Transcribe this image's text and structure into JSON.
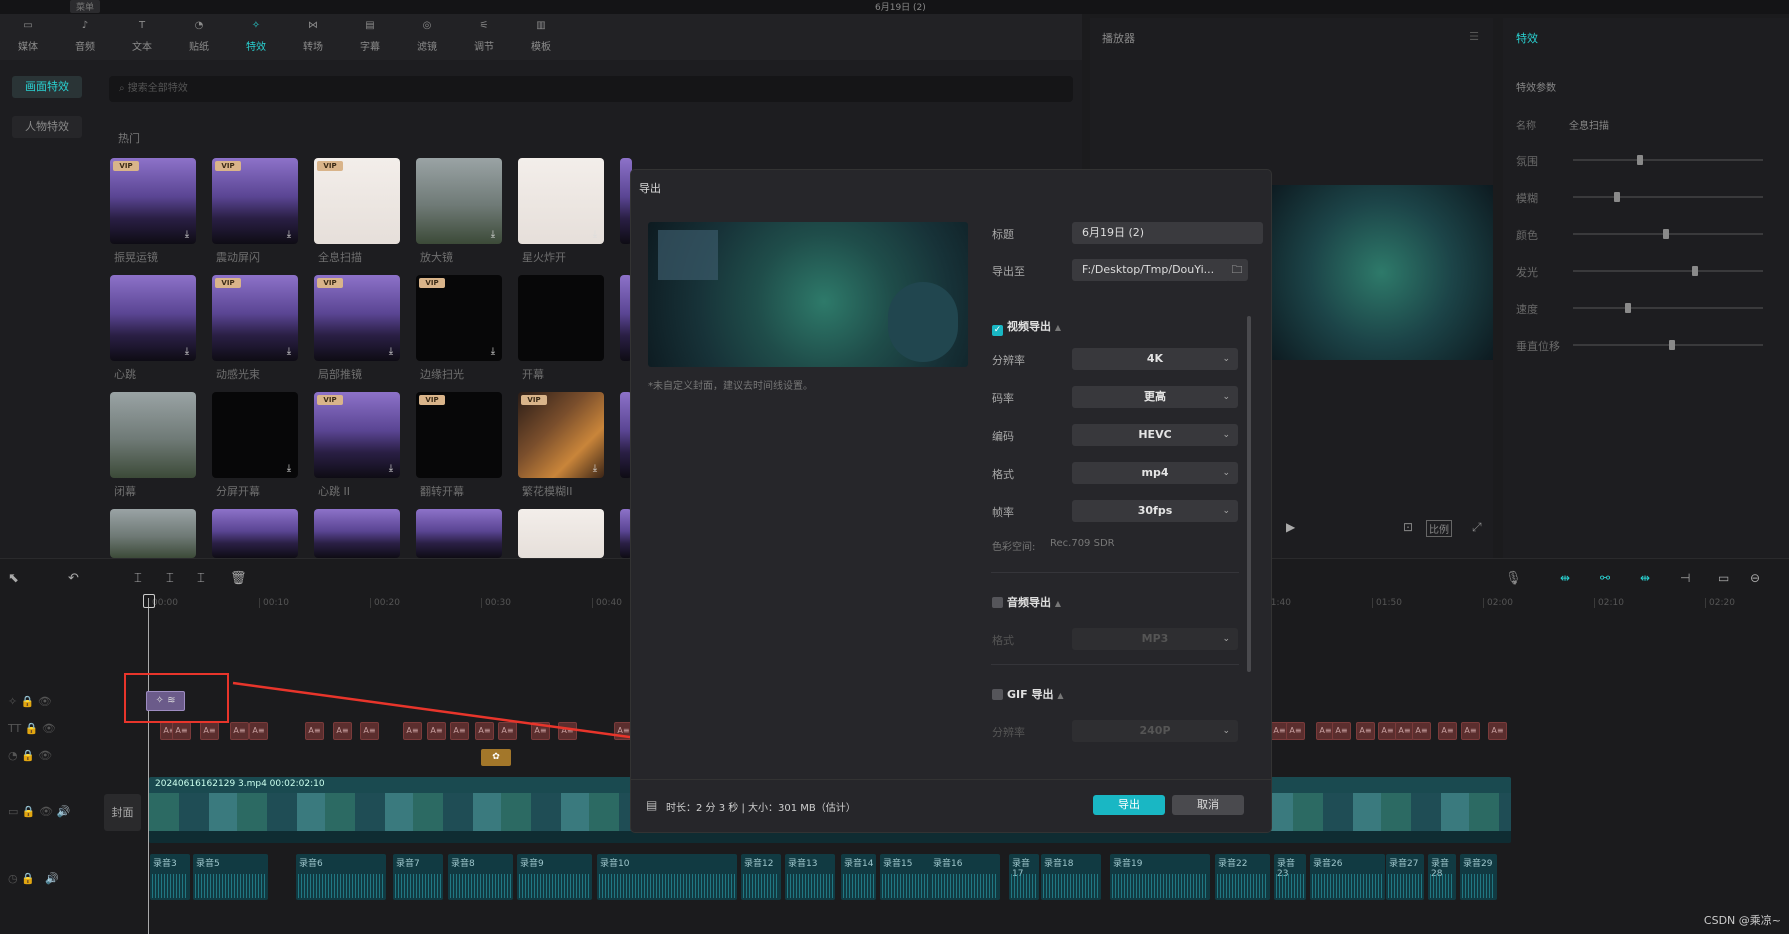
{
  "window": {
    "title": "6月19日 (2)",
    "menu": "菜单"
  },
  "toolbar": {
    "items": [
      "媒体",
      "音频",
      "文本",
      "贴纸",
      "特效",
      "转场",
      "字幕",
      "滤镜",
      "调节",
      "模板"
    ],
    "active_index": 4
  },
  "left_categories": [
    "画面特效",
    "人物特效"
  ],
  "effects": {
    "search_placeholder": "搜索全部特效",
    "section": "热门",
    "row1": [
      "振晃运镜",
      "震动屏闪",
      "全息扫描",
      "放大镜",
      "星火炸开"
    ],
    "row2": [
      "心跳",
      "动感光束",
      "局部推镜",
      "边缘扫光",
      "开幕"
    ],
    "row3": [
      "闭幕",
      "分屏开幕",
      "心跳 II",
      "翻转开幕",
      "繁花模糊II"
    ],
    "vip_label": "VIP"
  },
  "player": {
    "title": "播放器",
    "ratio_label": "比例"
  },
  "right_panel": {
    "title": "特效",
    "params_title": "特效参数",
    "name_label": "名称",
    "name_value": "全息扫描",
    "sliders": [
      {
        "label": "氛围",
        "value": 0.35
      },
      {
        "label": "模糊",
        "value": 0.23
      },
      {
        "label": "颜色",
        "value": 0.49
      },
      {
        "label": "发光",
        "value": 0.64
      },
      {
        "label": "速度",
        "value": 0.29
      },
      {
        "label": "垂直位移",
        "value": 0.52
      }
    ]
  },
  "timeline": {
    "ruler": [
      "00:00",
      "00:10",
      "00:20",
      "00:30",
      "00:40",
      "01:40",
      "01:50",
      "02:00",
      "02:10",
      "02:20"
    ],
    "video_clip": "20240616162129 3.mp4  00:02:02:10",
    "cover_label": "封面",
    "text_clip": "A≡",
    "audio_clips": [
      "录音3",
      "录音5",
      "录音6",
      "录音7",
      "录音8",
      "录音9",
      "录音10",
      "录音12",
      "录音13",
      "录音14",
      "录音15",
      "录音16",
      "录音17",
      "录音18",
      "录音19",
      "录音22",
      "录音23",
      "录音26",
      "录音27",
      "录音28",
      "录音29"
    ]
  },
  "dialog": {
    "title": "导出",
    "cover_hint": "*未自定义封面，建议去时间线设置。",
    "title_label": "标题",
    "title_value": "6月19日 (2)",
    "path_label": "导出至",
    "path_value": "F:/Desktop/Tmp/DouYi...",
    "video_export": "视频导出",
    "resolution_label": "分辨率",
    "resolution_value": "4K",
    "bitrate_label": "码率",
    "bitrate_value": "更高",
    "codec_label": "编码",
    "codec_value": "HEVC",
    "format_label": "格式",
    "format_value": "mp4",
    "fps_label": "帧率",
    "fps_value": "30fps",
    "colorspace_label": "色彩空间:",
    "colorspace_value": "Rec.709 SDR",
    "audio_export": "音频导出",
    "audio_format_label": "格式",
    "audio_format_value": "MP3",
    "gif_export": "GIF 导出",
    "gif_res_label": "分辨率",
    "gif_res_value": "240P",
    "footer_info": "时长：2 分 3 秒 | 大小：301 MB（估计）",
    "export_btn": "导出",
    "cancel_btn": "取消"
  },
  "watermark": "CSDN @乘凉~",
  "colors": {
    "accent": "#2ad2d2",
    "export_button": "#19b7c4",
    "annotation": "#e8352b"
  }
}
